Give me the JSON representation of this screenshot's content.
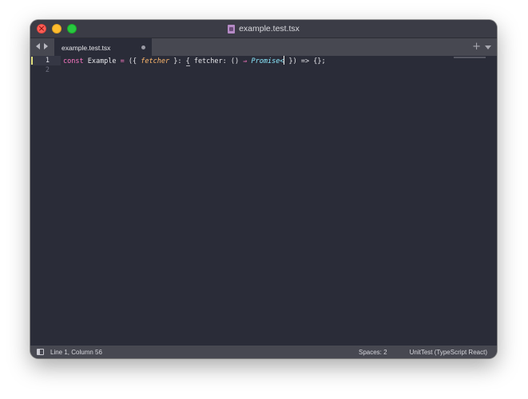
{
  "window": {
    "title": "example.test.tsx",
    "file_icon": "typescript-file-icon"
  },
  "tabs": [
    {
      "label": "example.test.tsx",
      "dirty": true,
      "active": true
    }
  ],
  "editor": {
    "lines": [
      {
        "number": "1",
        "tokens": {
          "t1": "const",
          "t2": " Example ",
          "t3": "=",
          "t4": " ({ ",
          "t5": "fetcher",
          "t6": " }: ",
          "t7": "{",
          "t8": " fetcher: () ",
          "t9": "⇒",
          "t10": " ",
          "t11": "Promise",
          "t12": "<",
          "t13": " }) => {};"
        }
      },
      {
        "number": "2",
        "text": ""
      }
    ]
  },
  "statusbar": {
    "position": "Line 1, Column 56",
    "spaces": "Spaces: 2",
    "syntax": "UnitTest (TypeScript React)"
  },
  "colors": {
    "background": "#2a2c38",
    "keyword": "#ff79c6",
    "parameter": "#ffb86c",
    "type": "#8be9fd",
    "text": "#e4e4e8"
  }
}
